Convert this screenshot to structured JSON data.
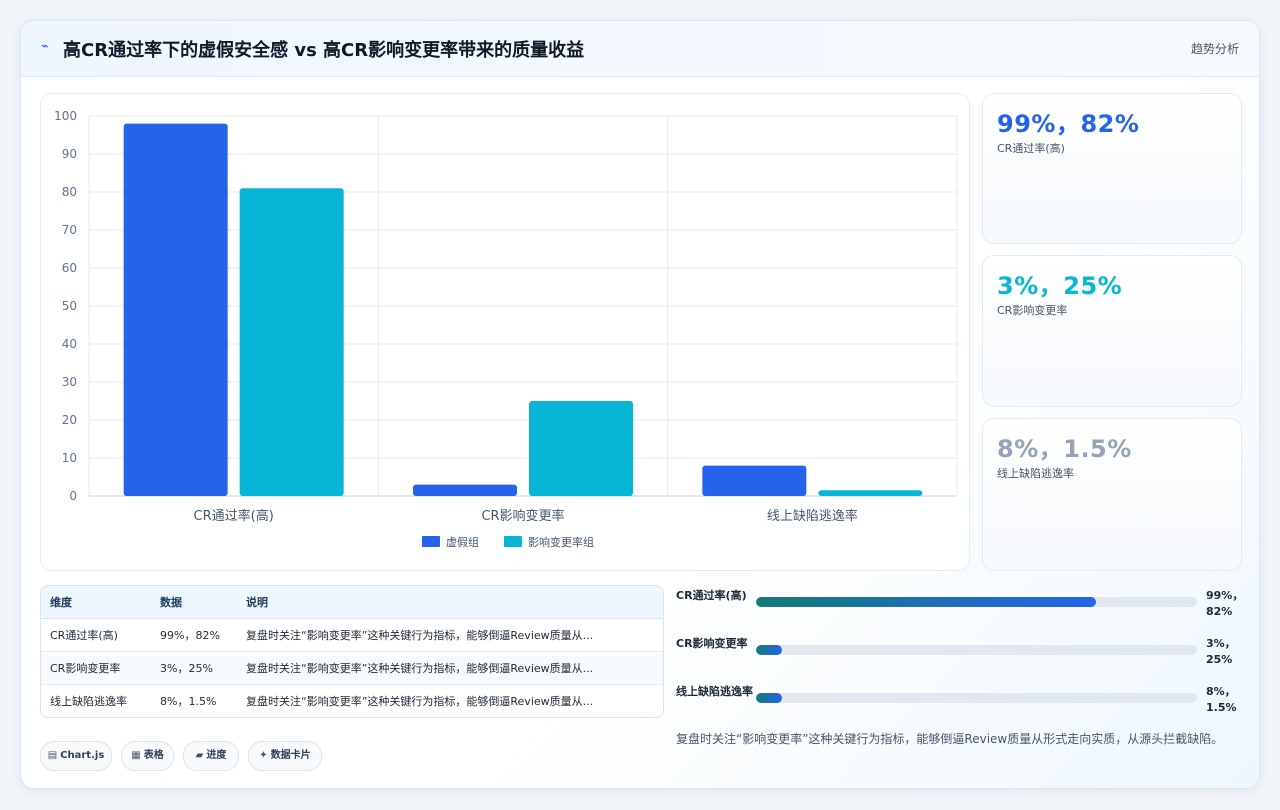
{
  "header": {
    "title": "高CR通过率下的虚假安全感 vs 高CR影响变更率带来的质量收益",
    "icon": "pulse-icon",
    "tag": "趋势分析"
  },
  "colors": {
    "series_a": "#2563eb",
    "series_b": "#06b6d4",
    "muted": "#94a3b8"
  },
  "chart_data": {
    "type": "bar",
    "categories": [
      "CR通过率(高)",
      "CR影响变更率",
      "线上缺陷逃逸率"
    ],
    "series": [
      {
        "name": "虚假组",
        "values": [
          98,
          3,
          8
        ],
        "color": "#2563eb"
      },
      {
        "name": "影响变更率组",
        "values": [
          81,
          25,
          1.5
        ],
        "color": "#06b6d4"
      }
    ],
    "ylim": [
      0,
      100
    ],
    "yticks": [
      0,
      10,
      20,
      30,
      40,
      50,
      60,
      70,
      80,
      90,
      100
    ],
    "grid": true,
    "legend": "bottom-center"
  },
  "stats": [
    {
      "value": "99%，82%",
      "label": "CR通过率(高)",
      "color": "#2563eb"
    },
    {
      "value": "3%，25%",
      "label": "CR影响变更率",
      "color": "#06b6d4"
    },
    {
      "value": "8%，1.5%",
      "label": "线上缺陷逃逸率",
      "color": "#94a3b8"
    }
  ],
  "table": {
    "headers": [
      "维度",
      "数据",
      "说明"
    ],
    "rows": [
      [
        "CR通过率(高)",
        "99%，82%",
        "复盘时关注“影响变更率”这种关键行为指标，能够倒逼Review质量从..."
      ],
      [
        "CR影响变更率",
        "3%，25%",
        "复盘时关注“影响变更率”这种关键行为指标，能够倒逼Review质量从..."
      ],
      [
        "线上缺陷逃逸率",
        "8%，1.5%",
        "复盘时关注“影响变更率”这种关键行为指标，能够倒逼Review质量从..."
      ]
    ]
  },
  "chips": [
    {
      "icon": "chart-icon",
      "glyph": "▤",
      "label": "Chart.js"
    },
    {
      "icon": "table-icon",
      "glyph": "▦",
      "label": "表格"
    },
    {
      "icon": "progress-icon",
      "glyph": "▰",
      "label": "进度"
    },
    {
      "icon": "sparkle-icon",
      "glyph": "✦",
      "label": "数据卡片"
    }
  ],
  "progress": [
    {
      "label": "CR通过率(高)",
      "value": "99%，82%",
      "fill": 0.77
    },
    {
      "label": "CR影响变更率",
      "value": "3%，25%",
      "fill": 0.06
    },
    {
      "label": "线上缺陷逃逸率",
      "value": "8%，1.5%",
      "fill": 0.06
    }
  ],
  "note": "复盘时关注“影响变更率”这种关键行为指标，能够倒逼Review质量从形式走向实质，从源头拦截缺陷。"
}
